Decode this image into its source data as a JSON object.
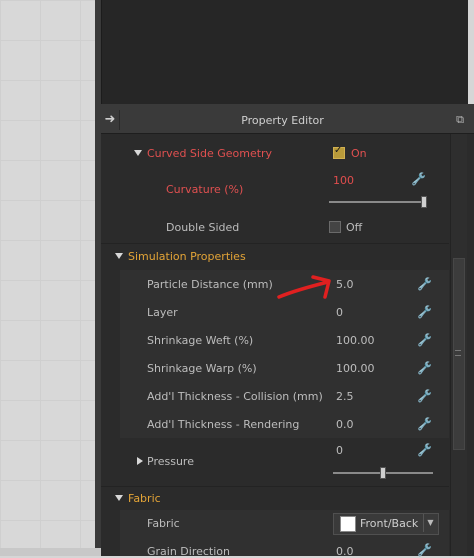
{
  "panel": {
    "title": "Property Editor"
  },
  "curved": {
    "section_label": "Curved Side Geometry",
    "toggle_label": "On",
    "curvature_label": "Curvature (%)",
    "curvature_value": "100",
    "curvature_slider_fraction": 0.98,
    "double_sided_label": "Double Sided",
    "double_sided_value": "Off"
  },
  "simulation": {
    "section_label": "Simulation Properties",
    "rows": [
      {
        "label": "Particle Distance (mm)",
        "value": "5.0"
      },
      {
        "label": "Layer",
        "value": "0"
      },
      {
        "label": "Shrinkage Weft (%)",
        "value": "100.00"
      },
      {
        "label": "Shrinkage Warp (%)",
        "value": "100.00"
      },
      {
        "label": "Add'l Thickness - Collision (mm)",
        "value": "2.5"
      },
      {
        "label": "Add'l Thickness - Rendering (mm",
        "value": "0.0"
      }
    ],
    "pressure_label": "Pressure",
    "pressure_value": "0",
    "pressure_slider_fraction": 0.5
  },
  "fabric": {
    "section_label": "Fabric",
    "fabric_label": "Fabric",
    "fabric_value": "Front/Back",
    "grain_label": "Grain Direction",
    "grain_value": "0.0"
  },
  "colors": {
    "accent_red": "#e05050",
    "section_orange": "#e3a437",
    "background": "#2b2b2b"
  }
}
